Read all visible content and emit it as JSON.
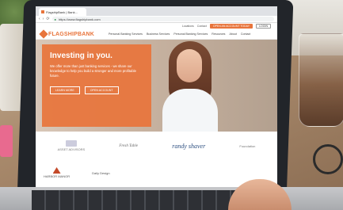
{
  "browser": {
    "tab_title": "FlagshipBank | Bank...",
    "url": "https://www.flagshipbank.com",
    "back": "‹",
    "forward": "›",
    "reload": "⟳",
    "lock": "🔒"
  },
  "utility_bar": {
    "link_1": "Locations",
    "link_2": "Contact",
    "open_account": "OPEN AN ACCOUNT TODAY",
    "login": "LOGIN"
  },
  "site": {
    "brand": "FLAGSHIPBANK",
    "nav": [
      "Personal Banking Services",
      "Business Services",
      "Personal Banking Services",
      "Resources",
      "About",
      "Contact"
    ]
  },
  "hero": {
    "title": "Investing in you.",
    "body": "We offer more than just banking services - we share our knowledge to help you build a stronger and more profitable future.",
    "button_1": "LEARN MORE",
    "button_2": "OPEN ACCOUNT"
  },
  "sponsors": [
    "ASSET ADVISORS",
    "Fresh Table",
    "Randy Shaver",
    "Foundation"
  ],
  "sponsor_feature": "randy shaver",
  "footer_logos": [
    "HARBOR MANOR",
    "Daily Design"
  ],
  "colors": {
    "brand_orange": "#e8743b",
    "sponsor_blue": "#2d4f80"
  }
}
